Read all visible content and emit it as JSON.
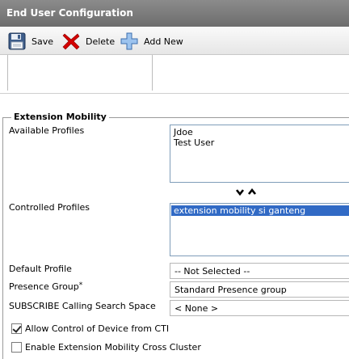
{
  "window": {
    "title": "End User Configuration"
  },
  "toolbar": {
    "save_label": "Save",
    "delete_label": "Delete",
    "add_new_label": "Add New"
  },
  "extension_mobility": {
    "legend": "Extension Mobility",
    "available_profiles": {
      "label": "Available Profiles",
      "items": [
        "Jdoe",
        "Test User"
      ]
    },
    "controlled_profiles": {
      "label": "Controlled Profiles",
      "items": [
        "extension mobility si ganteng"
      ],
      "selected_index": 0
    },
    "default_profile": {
      "label": "Default Profile",
      "value": "-- Not Selected --"
    },
    "presence_group": {
      "label": "Presence Group",
      "required_mark": "*",
      "value": "Standard Presence group"
    },
    "subscribe_css": {
      "label": "SUBSCRIBE Calling Search Space",
      "value": "< None >"
    },
    "allow_cti": {
      "label": "Allow Control of Device from CTI",
      "checked": true
    },
    "em_cross_cluster": {
      "label": "Enable Extension Mobility Cross Cluster",
      "checked": false
    }
  },
  "icons": {
    "save": "floppy-disk-icon",
    "delete": "red-x-icon",
    "add_new": "blue-plus-icon",
    "move_down": "chevron-down-icon",
    "move_up": "chevron-up-icon"
  },
  "colors": {
    "titlebar": "#7a7a7a",
    "selection": "#316ac5",
    "delete_red": "#d40000",
    "add_blue": "#4a8ad6"
  }
}
